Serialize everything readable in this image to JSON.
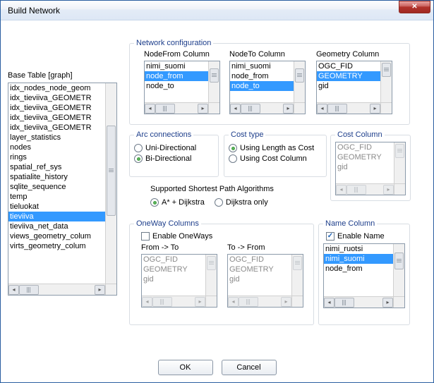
{
  "window": {
    "title": "Build Network"
  },
  "base_table": {
    "label": "Base Table [graph]",
    "items": [
      "idx_nodes_node_geom",
      "idx_tieviiva_GEOMETR",
      "idx_tieviiva_GEOMETR",
      "idx_tieviiva_GEOMETR",
      "idx_tieviiva_GEOMETR",
      "layer_statistics",
      "nodes",
      "rings",
      "spatial_ref_sys",
      "spatialite_history",
      "sqlite_sequence",
      "temp",
      "tieluokat",
      "tieviiva",
      "tieviiva_net_data",
      "views_geometry_colum",
      "virts_geometry_colum"
    ],
    "selected_index": 13
  },
  "network_config": {
    "legend": "Network configuration",
    "node_from": {
      "label": "NodeFrom Column",
      "items": [
        "nimi_suomi",
        "node_from",
        "node_to"
      ],
      "selected_index": 1
    },
    "node_to": {
      "label": "NodeTo Column",
      "items": [
        "nimi_suomi",
        "node_from",
        "node_to"
      ],
      "selected_index": 2
    },
    "geometry": {
      "label": "Geometry Column",
      "items": [
        "OGC_FID",
        "GEOMETRY",
        "gid"
      ],
      "selected_index": 1
    }
  },
  "arc": {
    "legend": "Arc connections",
    "uni": "Uni-Directional",
    "bi": "Bi-Directional",
    "selected": "bi"
  },
  "cost_type": {
    "legend": "Cost type",
    "length": "Using Length as Cost",
    "column": "Using Cost Column",
    "selected": "length"
  },
  "cost_column": {
    "legend": "Cost Column",
    "items": [
      "OGC_FID",
      "GEOMETRY",
      "gid"
    ]
  },
  "algorithms": {
    "label": "Supported Shortest Path Algorithms",
    "astar": "A* + Dijkstra",
    "dijkstra": "Dijkstra only",
    "selected": "astar"
  },
  "oneway": {
    "legend": "OneWay Columns",
    "enable_label": "Enable OneWays",
    "enabled": false,
    "from_to": {
      "label": "From -> To",
      "items": [
        "OGC_FID",
        "GEOMETRY",
        "gid"
      ]
    },
    "to_from": {
      "label": "To -> From",
      "items": [
        "OGC_FID",
        "GEOMETRY",
        "gid"
      ]
    }
  },
  "name_column": {
    "legend": "Name Column",
    "enable_label": "Enable Name",
    "enabled": true,
    "items": [
      "nimi_ruotsi",
      "nimi_suomi",
      "node_from"
    ],
    "selected_index": 1
  },
  "buttons": {
    "ok": "OK",
    "cancel": "Cancel"
  }
}
